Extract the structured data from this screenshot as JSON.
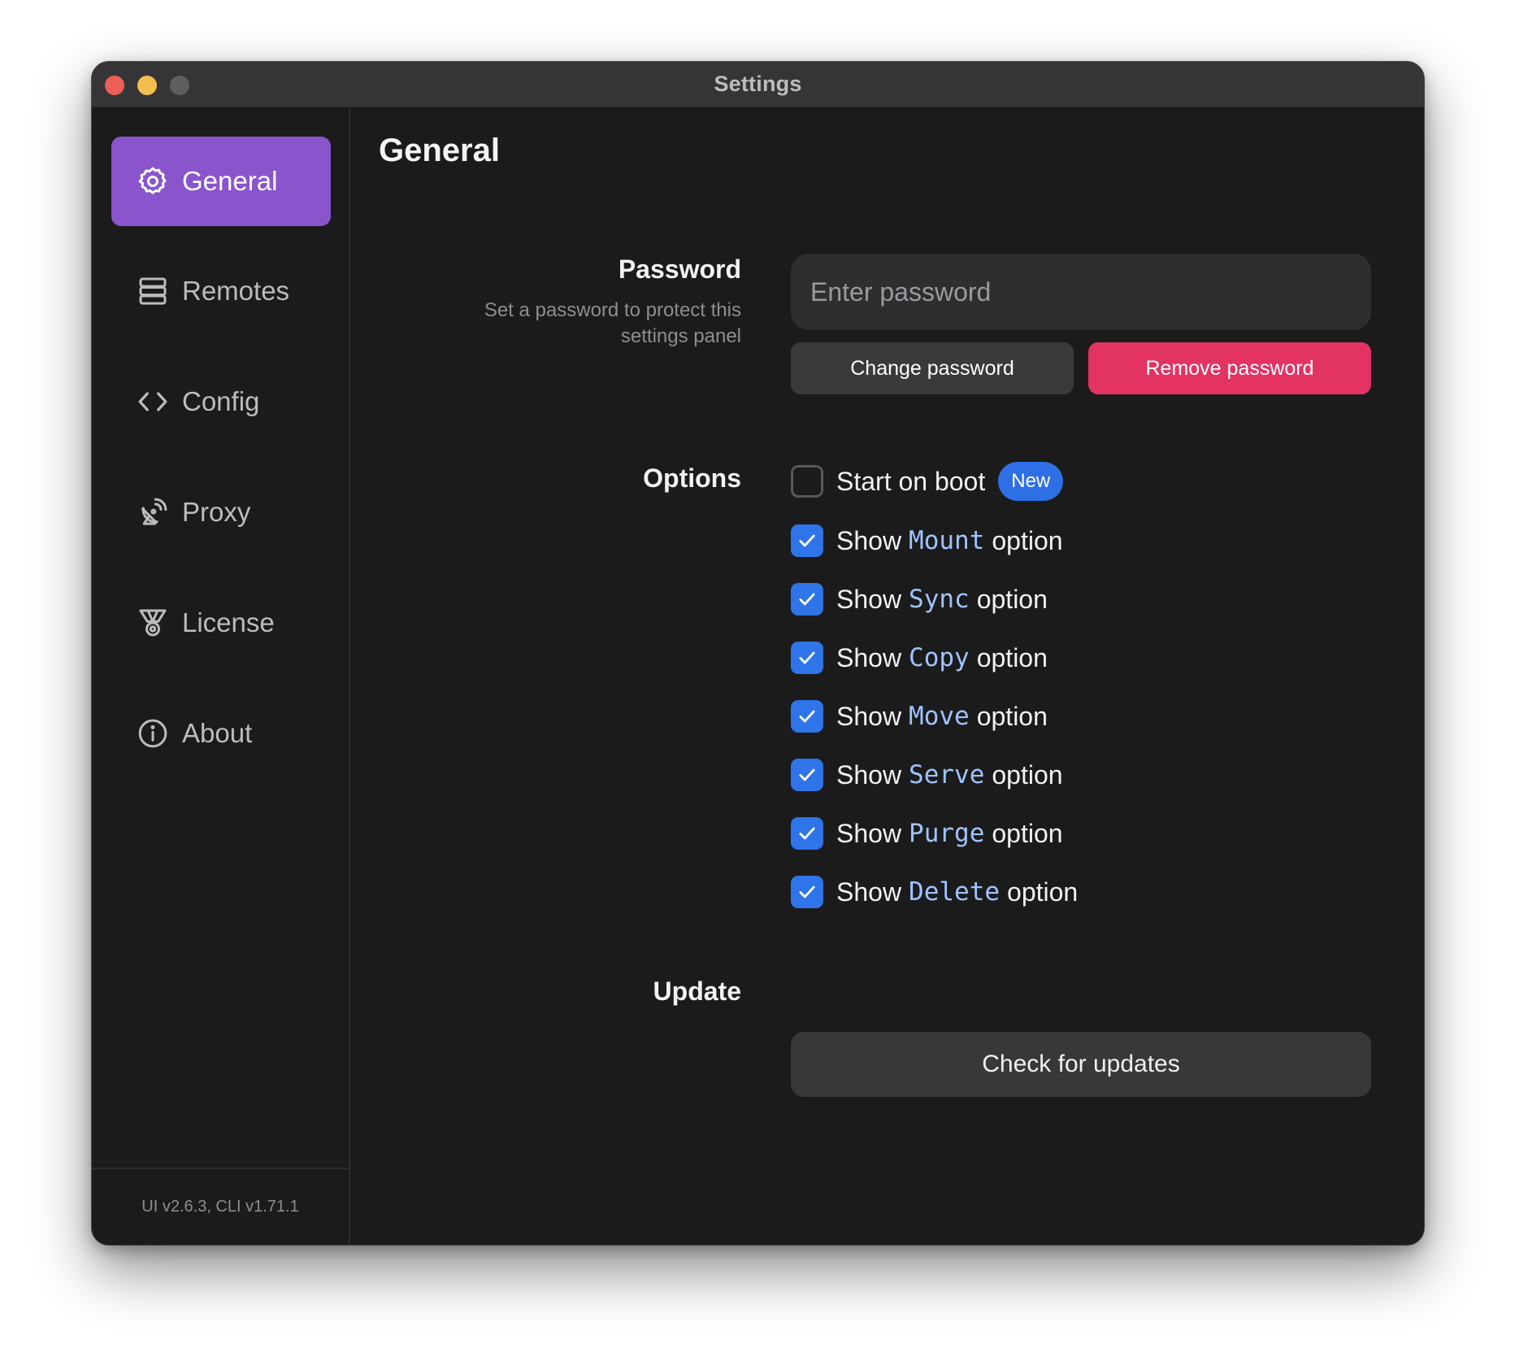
{
  "window": {
    "title": "Settings"
  },
  "sidebar": {
    "items": [
      {
        "label": "General",
        "icon": "gear-icon",
        "active": true
      },
      {
        "label": "Remotes",
        "icon": "server-icon",
        "active": false
      },
      {
        "label": "Config",
        "icon": "code-brackets-icon",
        "active": false
      },
      {
        "label": "Proxy",
        "icon": "satellite-dish-icon",
        "active": false
      },
      {
        "label": "License",
        "icon": "medal-icon",
        "active": false
      },
      {
        "label": "About",
        "icon": "info-icon",
        "active": false
      }
    ],
    "version": "UI v2.6.3, CLI v1.71.1"
  },
  "main": {
    "title": "General",
    "password": {
      "label": "Password",
      "description": "Set a password to protect this settings panel",
      "placeholder": "Enter password",
      "value": "",
      "change_label": "Change password",
      "remove_label": "Remove password"
    },
    "options": {
      "label": "Options",
      "start_on_boot": {
        "label": "Start on boot",
        "badge": "New",
        "checked": false
      },
      "items": [
        {
          "prefix": "Show",
          "keyword": "Mount",
          "suffix": "option",
          "checked": true
        },
        {
          "prefix": "Show",
          "keyword": "Sync",
          "suffix": "option",
          "checked": true
        },
        {
          "prefix": "Show",
          "keyword": "Copy",
          "suffix": "option",
          "checked": true
        },
        {
          "prefix": "Show",
          "keyword": "Move",
          "suffix": "option",
          "checked": true
        },
        {
          "prefix": "Show",
          "keyword": "Serve",
          "suffix": "option",
          "checked": true
        },
        {
          "prefix": "Show",
          "keyword": "Purge",
          "suffix": "option",
          "checked": true
        },
        {
          "prefix": "Show",
          "keyword": "Delete",
          "suffix": "option",
          "checked": true
        }
      ]
    },
    "update": {
      "label": "Update",
      "button_label": "Check for updates"
    }
  },
  "colors": {
    "accent_purple": "#8a55cc",
    "checkbox_blue": "#2f74e8",
    "danger_red": "#e33363",
    "keyword_blue": "#9fc3ff",
    "background": "#1b1b1c"
  }
}
